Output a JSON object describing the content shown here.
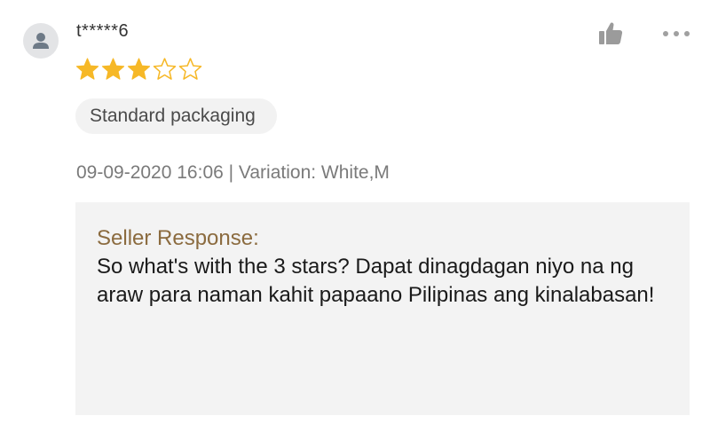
{
  "review": {
    "username": "t*****6",
    "rating": 3,
    "max_rating": 5,
    "tag": "Standard packaging",
    "meta": "09-09-2020 16:06 | Variation: White,M",
    "seller_response": {
      "label": "Seller Response:",
      "text": "So what's with the 3 stars? Dapat dinagdagan niyo na ng araw para naman kahit papaano Pilipinas ang kinalabasan!"
    }
  },
  "icons": {
    "avatar": "user-icon",
    "like": "thumbs-up-icon",
    "more": "more-dots-icon",
    "star_filled": "star-filled-icon",
    "star_empty": "star-outline-icon"
  },
  "colors": {
    "star": "#f6b827",
    "seller_label": "#8b6b3f",
    "response_bg": "#f3f3f3",
    "tag_bg": "#f2f2f2"
  }
}
